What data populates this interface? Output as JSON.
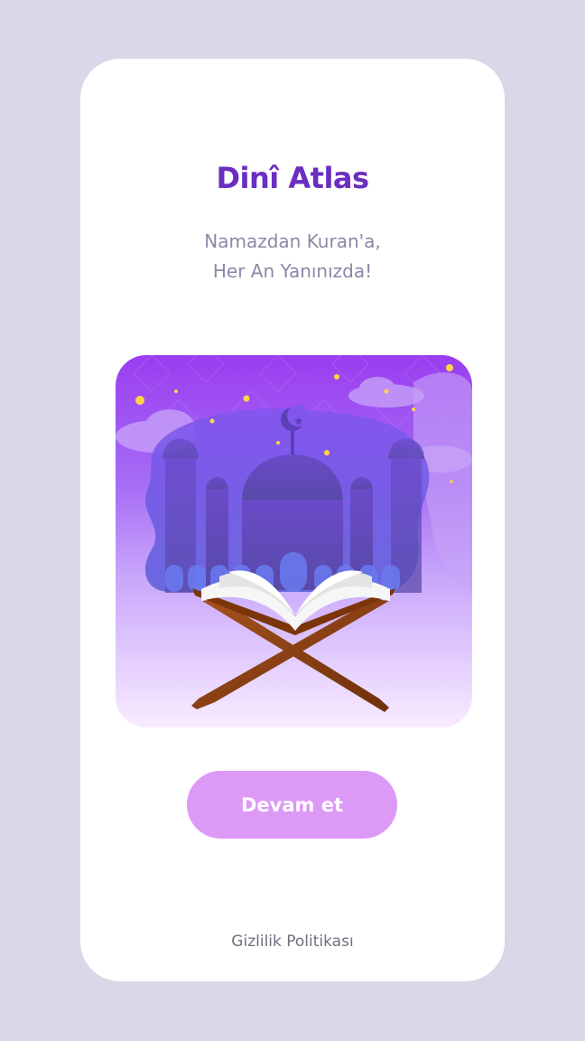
{
  "app": {
    "title": "Dinî Atlas",
    "tagline_line1": "Namazdan Kuran'a,",
    "tagline_line2": "Her An Yanınızda!"
  },
  "hero": {
    "icon": "mosque-quran-illustration"
  },
  "actions": {
    "continue_label": "Devam et",
    "privacy_label": "Gizlilik Politikası"
  },
  "colors": {
    "background": "#d9d7e8",
    "card": "#ffffff",
    "title": "#6a2ec0",
    "tagline": "#8a89a6",
    "button": "#dd99f6",
    "button_text": "#ffffff",
    "link": "#6f7080"
  }
}
